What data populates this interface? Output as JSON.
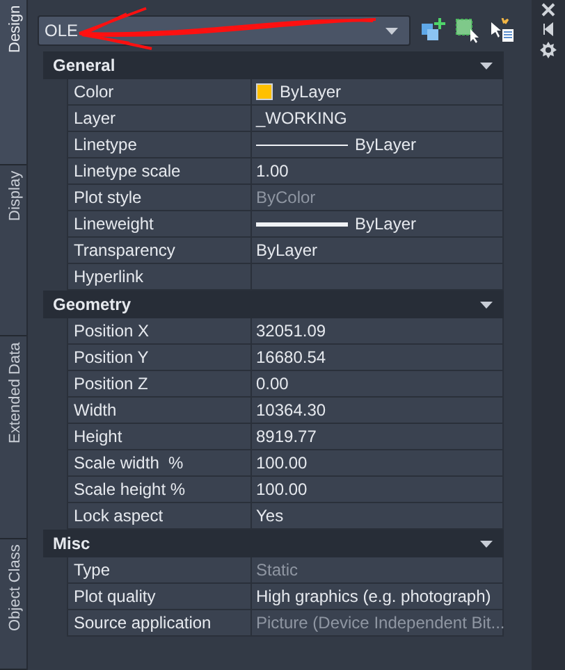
{
  "object_type": {
    "value": "OLE"
  },
  "side_tabs": [
    {
      "label": "Design",
      "selected": true
    },
    {
      "label": "Display",
      "selected": false
    },
    {
      "label": "Extended Data",
      "selected": false
    },
    {
      "label": "Object Class",
      "selected": false
    }
  ],
  "sections": [
    {
      "title": "General",
      "expanded": true,
      "rows": [
        {
          "label": "Color",
          "value": "ByLayer",
          "kind": "color",
          "color": "#ffc000",
          "disabled": false
        },
        {
          "label": "Layer",
          "value": "_WORKING",
          "kind": "text",
          "disabled": false
        },
        {
          "label": "Linetype",
          "value": "ByLayer",
          "kind": "linetype",
          "disabled": false
        },
        {
          "label": "Linetype scale",
          "value": "1.00",
          "kind": "text",
          "disabled": false
        },
        {
          "label": "Plot style",
          "value": "ByColor",
          "kind": "text",
          "disabled": true
        },
        {
          "label": "Lineweight",
          "value": "ByLayer",
          "kind": "lineweight",
          "disabled": false
        },
        {
          "label": "Transparency",
          "value": "ByLayer",
          "kind": "text",
          "disabled": false
        },
        {
          "label": "Hyperlink",
          "kind": "text",
          "disabled": false
        }
      ]
    },
    {
      "title": "Geometry",
      "expanded": true,
      "rows": [
        {
          "label": "Position X",
          "value": "32051.09",
          "kind": "text",
          "disabled": false
        },
        {
          "label": "Position Y",
          "value": "16680.54",
          "kind": "text",
          "disabled": false
        },
        {
          "label": "Position Z",
          "value": "0.00",
          "kind": "text",
          "disabled": false
        },
        {
          "label": "Width",
          "value": "10364.30",
          "kind": "text",
          "disabled": false
        },
        {
          "label": "Height",
          "value": "8919.77",
          "kind": "text",
          "disabled": false
        },
        {
          "label": "Scale width  %",
          "value": "100.00",
          "kind": "text",
          "disabled": false
        },
        {
          "label": "Scale height %",
          "value": "100.00",
          "kind": "text",
          "disabled": false
        },
        {
          "label": "Lock aspect",
          "value": "Yes",
          "kind": "text",
          "disabled": false
        }
      ]
    },
    {
      "title": "Misc",
      "expanded": true,
      "rows": [
        {
          "label": "Type",
          "value": "Static",
          "kind": "text",
          "disabled": true
        },
        {
          "label": "Plot quality",
          "value": "High graphics (e.g. photograph)",
          "kind": "text",
          "disabled": false
        },
        {
          "label": "Source application",
          "value": "Picture (Device Independent Bit...",
          "kind": "text",
          "disabled": true
        }
      ]
    }
  ]
}
